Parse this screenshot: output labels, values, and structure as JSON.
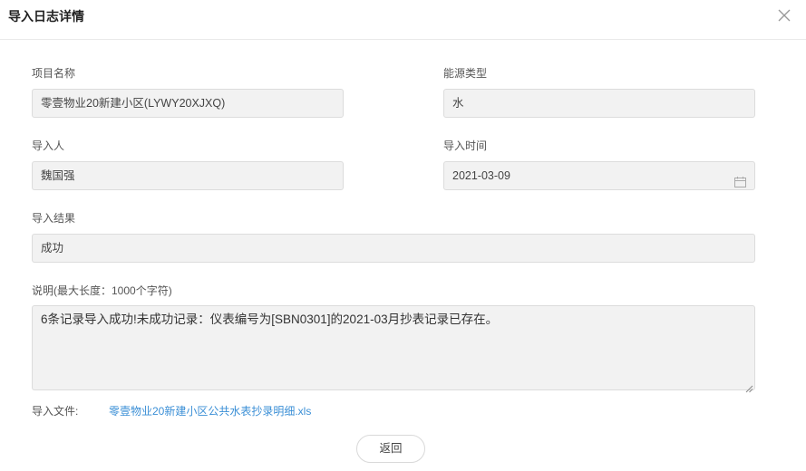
{
  "dialog": {
    "title": "导入日志详情"
  },
  "form": {
    "project_name": {
      "label": "项目名称",
      "value": "零壹物业20新建小区(LYWY20XJXQ)"
    },
    "energy_type": {
      "label": "能源类型",
      "value": "水"
    },
    "importer": {
      "label": "导入人",
      "value": "魏国强"
    },
    "import_time": {
      "label": "导入时间",
      "value": "2021-03-09"
    },
    "import_result": {
      "label": "导入结果",
      "value": "成功"
    },
    "description": {
      "label": "说明(最大长度：1000个字符)",
      "value": "6条记录导入成功!未成功记录：仪表编号为[SBN0301]的2021-03月抄表记录已存在。"
    },
    "import_file": {
      "label": "导入文件:",
      "value": "零壹物业20新建小区公共水表抄录明细.xls"
    }
  },
  "actions": {
    "back_label": "返回"
  },
  "icons": {
    "close": "close-icon",
    "calendar": "calendar-icon"
  }
}
